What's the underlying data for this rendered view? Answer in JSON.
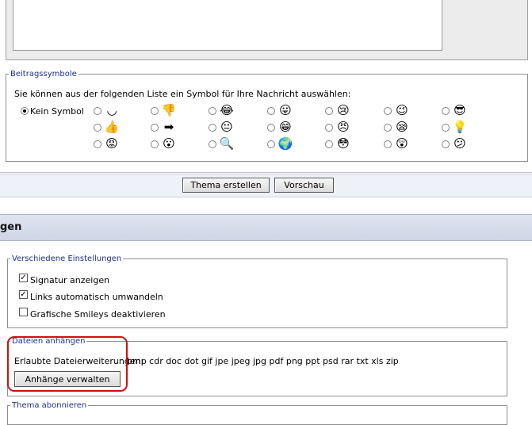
{
  "post_icons": {
    "legend": "Beitragssymbole",
    "instruction": "Sie können aus der folgenden Liste ein Symbol für Ihre Nachricht auswählen:",
    "no_icon_label": "Kein Symbol",
    "icons": [
      {
        "name": "smile-icon",
        "glyph": "◡"
      },
      {
        "name": "thumbs-down-icon",
        "glyph": "👎"
      },
      {
        "name": "laugh-icon",
        "glyph": "😂"
      },
      {
        "name": "tongue-icon",
        "glyph": "😛"
      },
      {
        "name": "crying-icon",
        "glyph": "😢"
      },
      {
        "name": "wink-icon",
        "glyph": "😉"
      },
      {
        "name": "cool-icon",
        "glyph": "😎"
      },
      {
        "name": "thumbs-up-icon",
        "glyph": "👍"
      },
      {
        "name": "arrow-right-icon",
        "glyph": "➡"
      },
      {
        "name": "neutral-icon",
        "glyph": "😐"
      },
      {
        "name": "grin-icon",
        "glyph": "😁"
      },
      {
        "name": "angry-icon",
        "glyph": "😠"
      },
      {
        "name": "sleepy-icon",
        "glyph": "😪"
      },
      {
        "name": "lightbulb-icon",
        "glyph": "💡"
      },
      {
        "name": "mad-icon",
        "glyph": "😡"
      },
      {
        "name": "surprised-icon",
        "glyph": "😮"
      },
      {
        "name": "magnifier-icon",
        "glyph": "🔍"
      },
      {
        "name": "globe-icon",
        "glyph": "🌍"
      },
      {
        "name": "embarrassed-icon",
        "glyph": "😳"
      },
      {
        "name": "shocked-icon",
        "glyph": "😲"
      },
      {
        "name": "confused-icon",
        "glyph": "😕"
      }
    ]
  },
  "buttons": {
    "create_topic": "Thema erstellen",
    "preview": "Vorschau"
  },
  "section": {
    "title_fragment": "gen"
  },
  "misc_settings": {
    "legend": "Verschiedene Einstellungen",
    "show_signature": "Signatur anzeigen",
    "auto_links": "Links automatisch umwandeln",
    "disable_smileys": "Grafische Smileys deaktivieren"
  },
  "attachments": {
    "legend": "Dateien anhängen",
    "allowed_label": "Erlaubte Dateierweiterungen:",
    "extensions": "bmp cdr doc dot gif jpe jpeg jpg pdf png ppt psd rar txt xls zip",
    "manage_button": "Anhänge verwalten"
  },
  "subscribe": {
    "legend": "Thema abonnieren"
  }
}
